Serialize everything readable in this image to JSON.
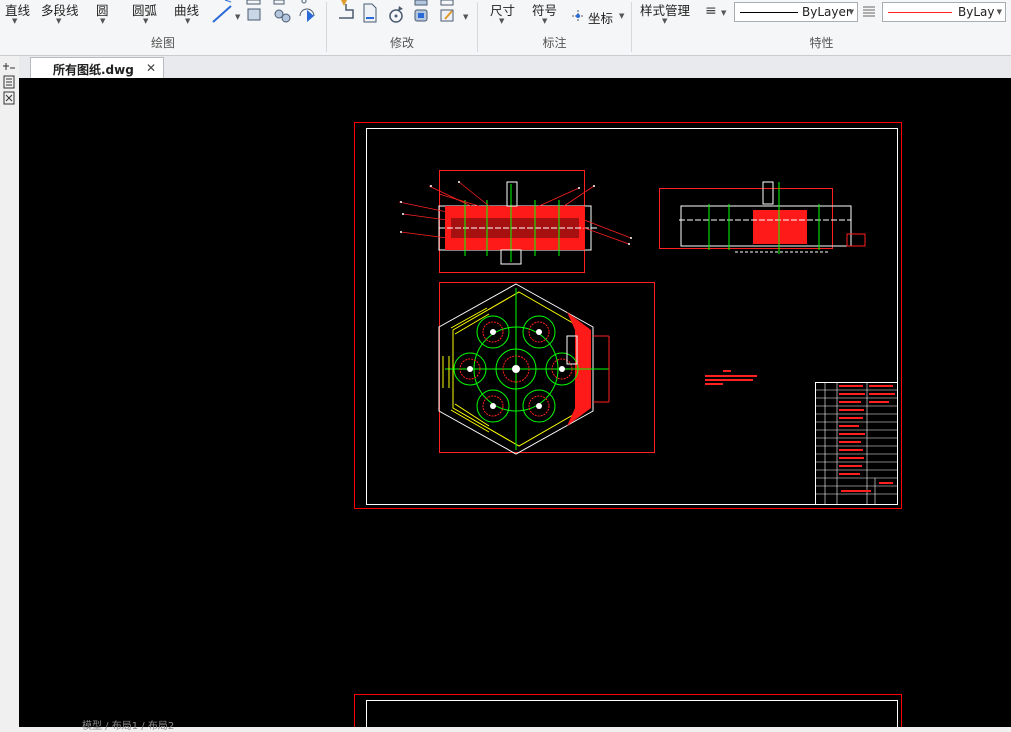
{
  "ribbon": {
    "draw": {
      "title": "绘图",
      "line": "直线",
      "polyline": "多段线",
      "circle": "圆",
      "arc": "圆弧",
      "curve": "曲线"
    },
    "modify": {
      "title": "修改"
    },
    "annotate": {
      "title": "标注",
      "dimension": "尺寸",
      "symbol": "符号",
      "coordinate": "坐标"
    },
    "properties": {
      "title": "特性",
      "style_manager": "样式管理",
      "linetype": "ByLayer",
      "color": "ByLay"
    }
  },
  "tabs": [
    {
      "label": "所有图纸.dwg"
    }
  ],
  "layout_tabs": "模型 / 布局1 / 布局2",
  "colors": {
    "canvas": "#000000",
    "frame": "#ff0000",
    "drawing_red": "#ff2020",
    "drawing_green": "#00ff00",
    "drawing_yellow": "#ffff00",
    "drawing_white": "#ffffff"
  }
}
